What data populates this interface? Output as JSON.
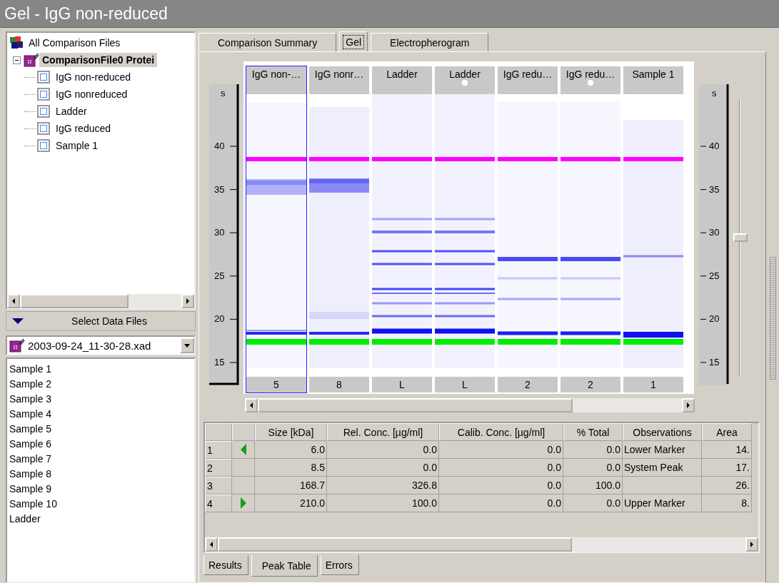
{
  "window": {
    "title": "Gel - IgG non-reduced"
  },
  "tree": {
    "label": "All Comparison Files",
    "children": [
      {
        "label": "ComparisonFile0 Protei",
        "expanded": true,
        "selected": true,
        "children": [
          {
            "label": "IgG non-reduced"
          },
          {
            "label": "IgG nonreduced"
          },
          {
            "label": "Ladder"
          },
          {
            "label": "IgG reduced"
          },
          {
            "label": "Sample 1"
          }
        ]
      }
    ]
  },
  "select_bar": {
    "label": "Select Data Files",
    "expanded": true
  },
  "file_dropdown": {
    "value": "2003-09-24_11-30-28.xad"
  },
  "samples": [
    "Sample 1",
    "Sample 2",
    "Sample 3",
    "Sample 4",
    "Sample 5",
    "Sample 6",
    "Sample 7",
    "Sample 8",
    "Sample 9",
    "Sample 10",
    "Ladder"
  ],
  "tabs": [
    {
      "label": "Comparison Summary",
      "selected": false
    },
    {
      "label": "Gel",
      "selected": true
    },
    {
      "label": "Electropherogram",
      "selected": false
    }
  ],
  "gel": {
    "left_axis": {
      "unit": "s",
      "ticks": [
        "40",
        "35",
        "30",
        "25",
        "20",
        "15"
      ]
    },
    "right_axis": {
      "unit": "s",
      "ticks": [
        "40",
        "35",
        "30",
        "25",
        "20",
        "15"
      ]
    },
    "zoom": {
      "level": 0.5
    },
    "lanes": [
      {
        "label": "IgG non-…",
        "footer": "5",
        "selected": true,
        "dot": false,
        "kind": "nonreduced"
      },
      {
        "label": "IgG nonr…",
        "footer": "8",
        "selected": false,
        "dot": false,
        "kind": "nonreduced2"
      },
      {
        "label": "Ladder",
        "footer": "L",
        "selected": false,
        "dot": false,
        "kind": "ladder"
      },
      {
        "label": "Ladder",
        "footer": "L",
        "selected": false,
        "dot": true,
        "kind": "ladder"
      },
      {
        "label": "IgG redu…",
        "footer": "2",
        "selected": false,
        "dot": false,
        "kind": "reduced"
      },
      {
        "label": "IgG redu…",
        "footer": "2",
        "selected": false,
        "dot": true,
        "kind": "reduced"
      },
      {
        "label": "Sample 1",
        "footer": "1",
        "selected": false,
        "dot": false,
        "kind": "sample"
      }
    ]
  },
  "peak_table": {
    "columns": [
      "Size [kDa]",
      "Rel. Conc. [µg/ml]",
      "Calib. Conc. [µg/ml]",
      "% Total",
      "Observations",
      "Area"
    ],
    "rows": [
      {
        "num": "1",
        "kind": "lower",
        "size": "6.0",
        "rel": "0.0",
        "calib": "0.0",
        "total": "0.0",
        "observations": "Lower Marker",
        "area": "14."
      },
      {
        "num": "2",
        "size": "8.5",
        "rel": "0.0",
        "calib": "0.0",
        "total": "0.0",
        "observations": "System Peak",
        "area": "17."
      },
      {
        "num": "3",
        "size": "168.7",
        "rel": "326.8",
        "calib": "0.0",
        "total": "100.0",
        "area": "26."
      },
      {
        "num": "4",
        "kind": "upper",
        "size": "210.0",
        "rel": "100.0",
        "calib": "0.0",
        "total": "0.0",
        "observations": "Upper Marker",
        "area": "8."
      }
    ]
  },
  "bottom_tabs": [
    {
      "label": "Results",
      "selected": false
    },
    {
      "label": "Peak Table",
      "selected": true
    },
    {
      "label": "Errors",
      "selected": false
    }
  ]
}
